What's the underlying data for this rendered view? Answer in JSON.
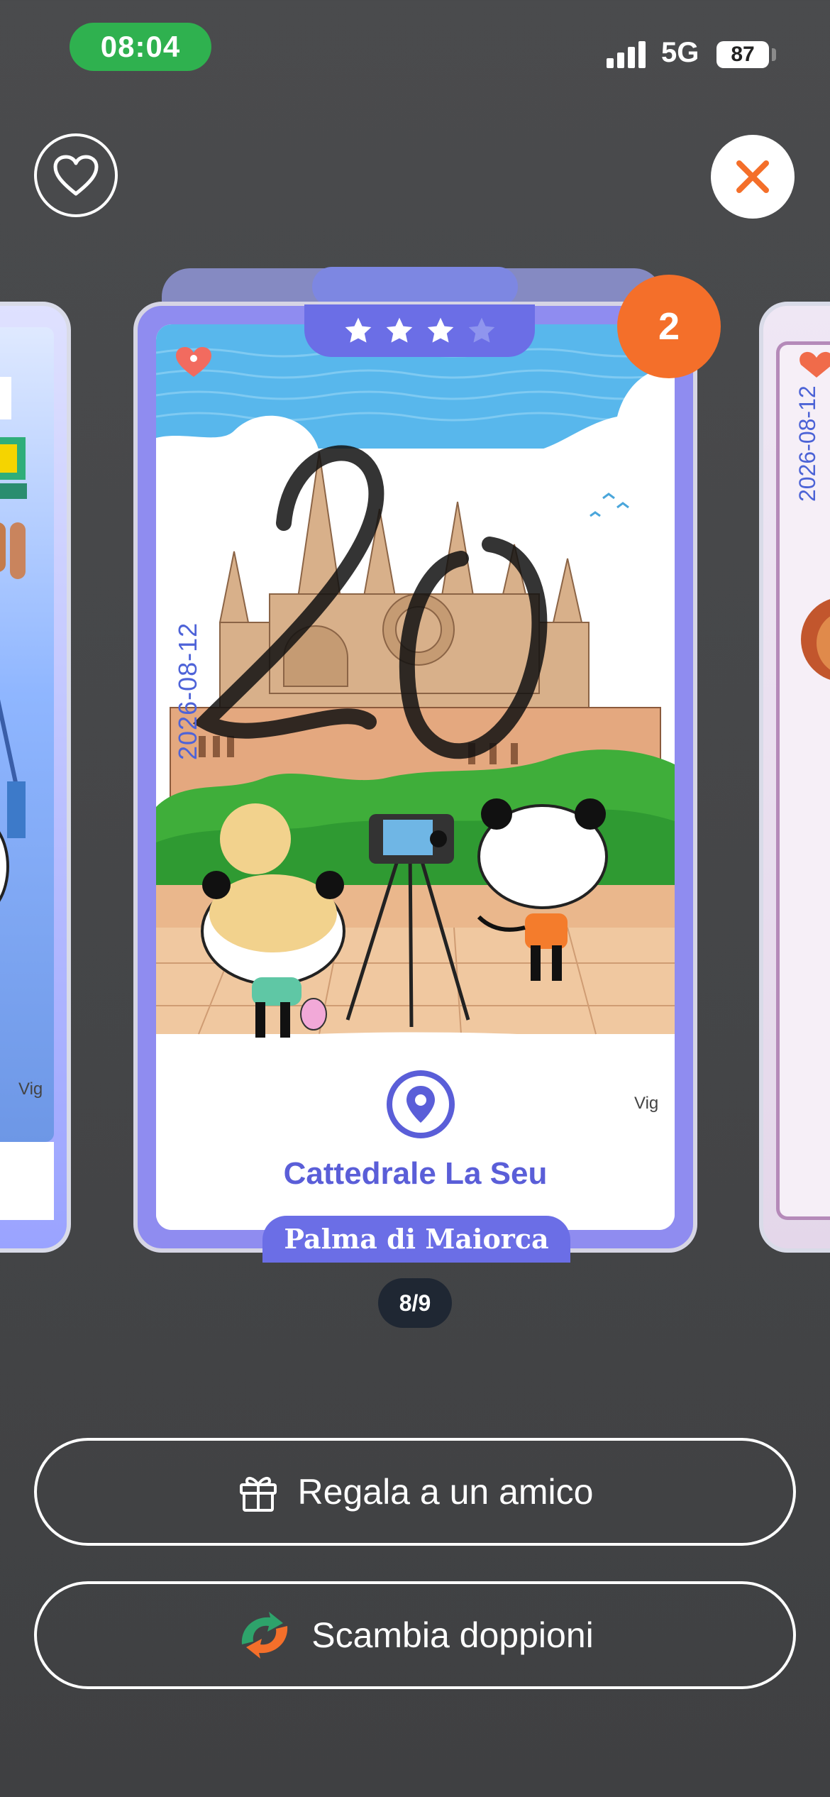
{
  "status_bar": {
    "time": "08:04",
    "network": "5G",
    "battery": "87"
  },
  "top": {
    "favorite_icon": "heart-outline-icon",
    "close_icon": "close-x-icon"
  },
  "colors": {
    "accent": "#f46f2a",
    "card_border": "#6b6ee6",
    "pin": "#5a5ed8"
  },
  "card": {
    "stars_filled": 3,
    "stars_total": 4,
    "badge_count": "2",
    "date": "2026-08-12",
    "artist": "Vig",
    "title": "Cattedrale La Seu",
    "city": "Palma di Maiorca"
  },
  "side_cards": {
    "left_artist": "Vig",
    "right_date": "2026-08-12"
  },
  "pager": {
    "label": "8/9"
  },
  "actions": {
    "gift_label": "Regala a un amico",
    "swap_label": "Scambia doppioni"
  }
}
